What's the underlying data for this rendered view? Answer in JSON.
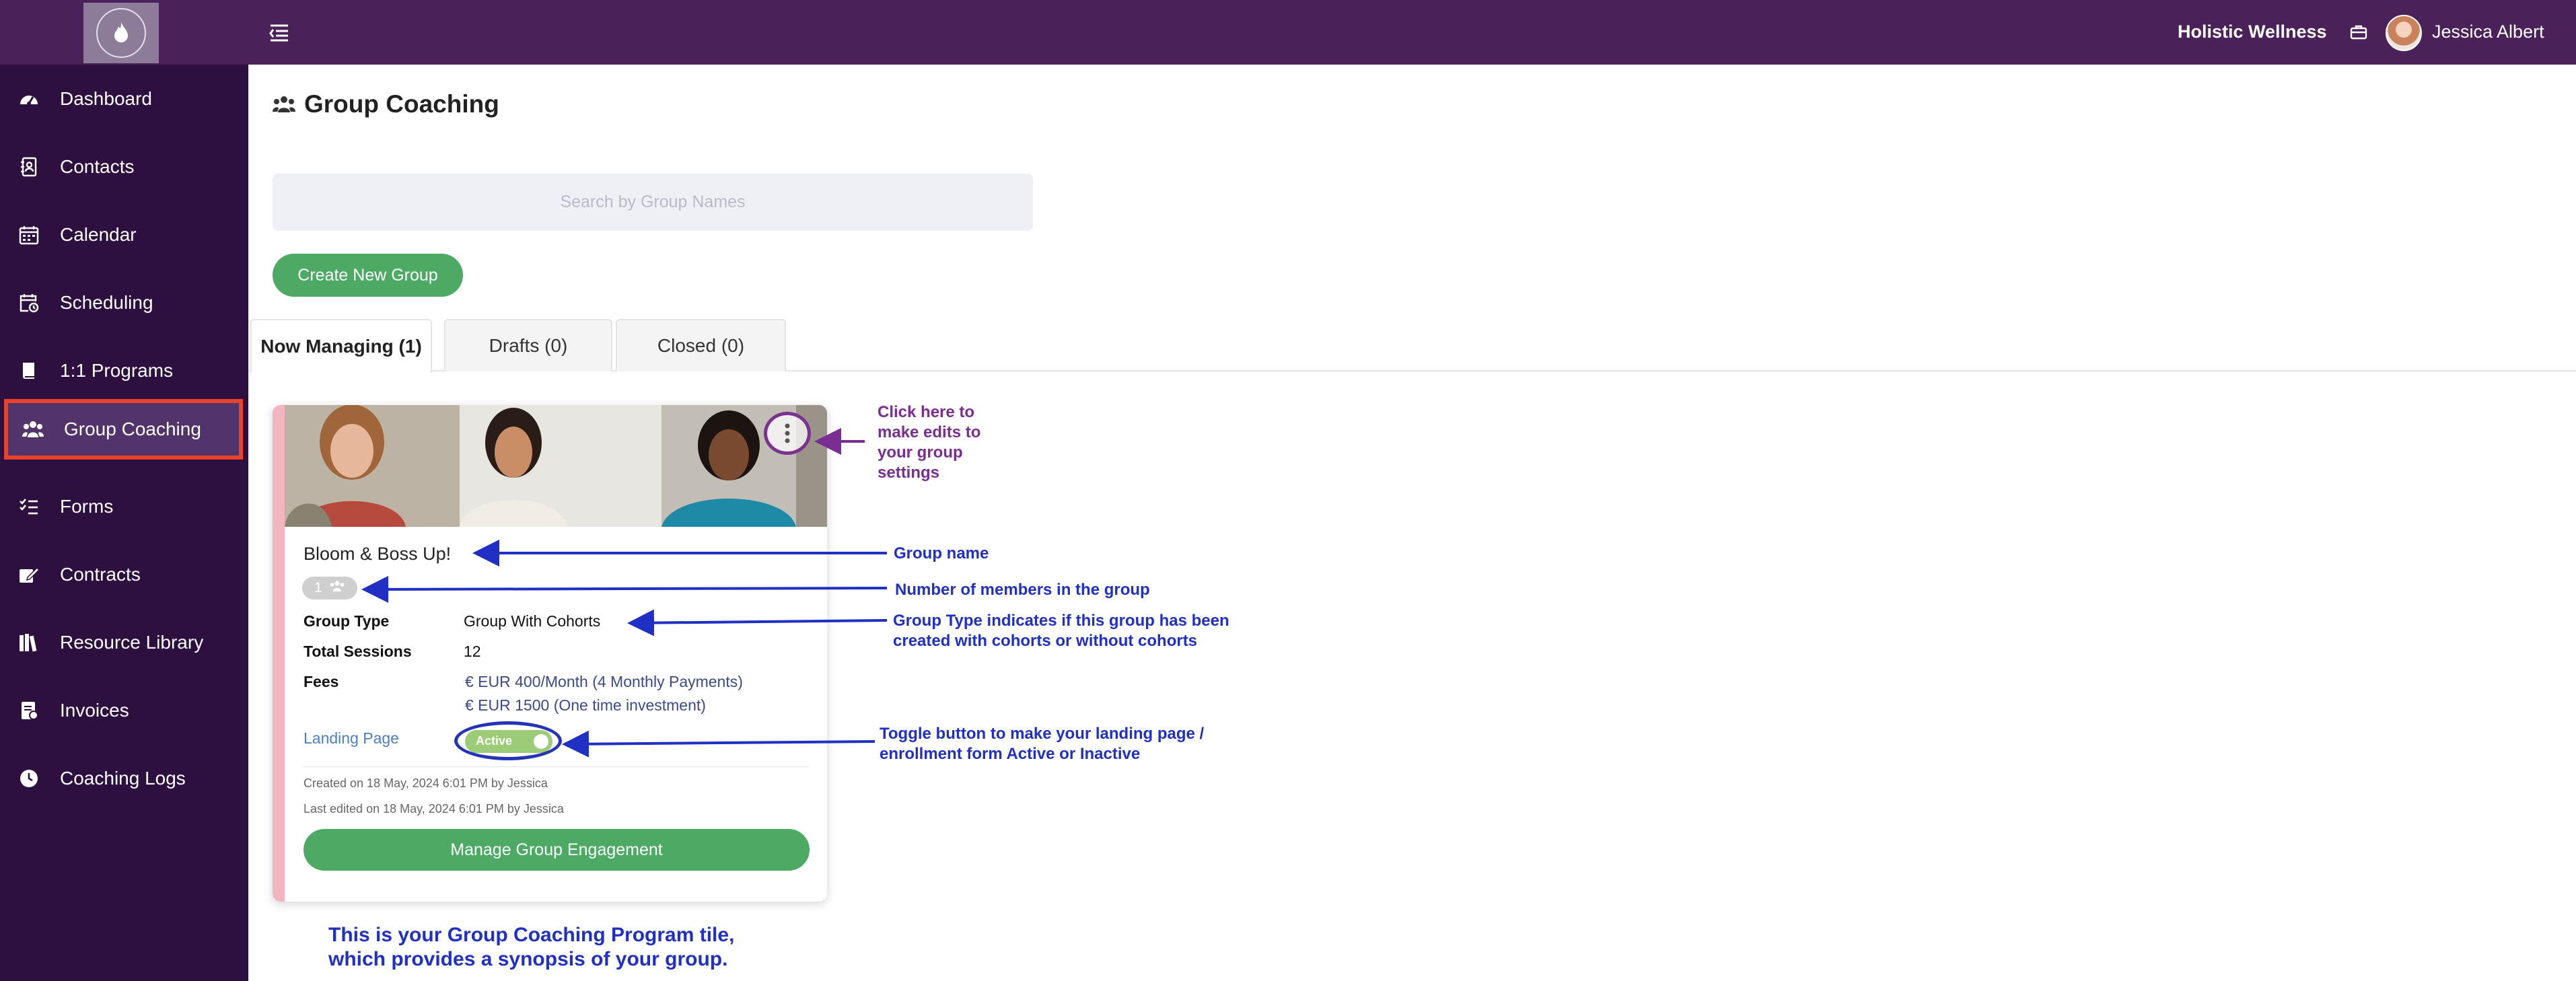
{
  "header": {
    "brand": "Holistic Wellness",
    "user_name": "Jessica Albert",
    "colors": {
      "topbar": "#4a2158",
      "sidebar": "#2e1040"
    }
  },
  "sidebar": {
    "items": [
      {
        "label": "Dashboard",
        "icon": "speedometer-icon",
        "active": false
      },
      {
        "label": "Contacts",
        "icon": "contact-book-icon",
        "active": false
      },
      {
        "label": "Calendar",
        "icon": "calendar-icon",
        "active": false
      },
      {
        "label": "Scheduling",
        "icon": "calendar-clock-icon",
        "active": false
      },
      {
        "label": "1:1 Programs",
        "icon": "book-icon",
        "active": false
      },
      {
        "label": "Group Coaching",
        "icon": "people-icon",
        "active": true
      },
      {
        "label": "Forms",
        "icon": "checklist-icon",
        "active": false
      },
      {
        "label": "Contracts",
        "icon": "pen-document-icon",
        "active": false
      },
      {
        "label": "Resource Library",
        "icon": "library-books-icon",
        "active": false
      },
      {
        "label": "Invoices",
        "icon": "invoice-icon",
        "active": false
      },
      {
        "label": "Coaching Logs",
        "icon": "clock-icon",
        "active": false
      }
    ]
  },
  "page": {
    "title": "Group Coaching",
    "search_placeholder": "Search by Group Names",
    "create_button": "Create New Group"
  },
  "tabs": [
    {
      "label": "Now Managing (1)",
      "active": true
    },
    {
      "label": "Drafts (0)",
      "active": false
    },
    {
      "label": "Closed (0)",
      "active": false
    }
  ],
  "card": {
    "name": "Bloom & Boss Up!",
    "member_count": "1",
    "group_type_label": "Group Type",
    "group_type_value": "Group With Cohorts",
    "total_sessions_label": "Total Sessions",
    "total_sessions_value": "12",
    "fees_label": "Fees",
    "fees": [
      "€ EUR 400/Month (4 Monthly Payments)",
      "€ EUR 1500 (One time investment)"
    ],
    "landing_page_label": "Landing Page",
    "toggle_text": "Active",
    "created": "Created on 18 May, 2024 6:01 PM by Jessica",
    "edited": "Last edited on 18 May, 2024 6:01 PM by Jessica",
    "manage_button": "Manage Group Engagement"
  },
  "annotations": {
    "edit_settings": [
      "Click here to",
      "make edits to",
      "your group",
      "settings"
    ],
    "group_name": "Group name",
    "members": "Number of members in the group",
    "group_type": [
      "Group Type indicates if this group has been",
      "created with cohorts or without cohorts"
    ],
    "toggle": [
      "Toggle button to make your landing page /",
      "enrollment form Active or Inactive"
    ],
    "tile": [
      "This is your Group Coaching Program tile,",
      "which provides a synopsis of your group."
    ],
    "colors": {
      "blue": "#2030c4",
      "purple": "#7a2d92"
    }
  }
}
